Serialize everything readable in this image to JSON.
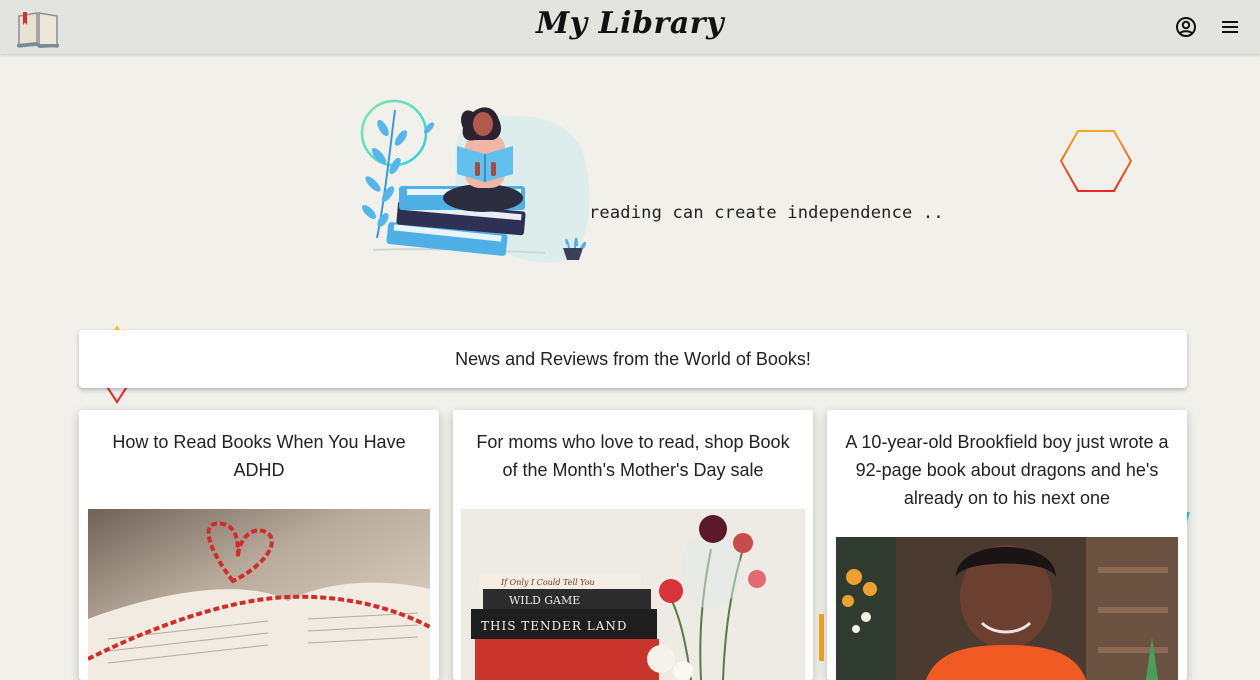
{
  "header": {
    "title": "My Library",
    "logo_icon": "open-book-icon",
    "account_icon": "account-circle-icon",
    "menu_icon": "hamburger-menu-icon"
  },
  "hero": {
    "tagline": "reading can create independence ..",
    "illustration": "woman-reading-on-books-illustration"
  },
  "news_banner": {
    "text": "News and Reviews from the World of Books!"
  },
  "articles": [
    {
      "title": "How to Read Books When You Have ADHD",
      "image": "open-book-with-red-string-heart-photo"
    },
    {
      "title": "For moms who love to read, shop Book of the Month's Mother's Day sale",
      "image": "stack-of-books-with-flowers-photo",
      "book_spines": [
        "If Only I Could Tell You",
        "WILD GAME",
        "THIS TENDER LAND"
      ]
    },
    {
      "title": "A 10-year-old Brookfield boy just wrote a 92-page book about dragons and he's already on to his next one",
      "image": "smiling-boy-portrait-photo"
    }
  ],
  "colors": {
    "page_background": "#f1f0ea",
    "topbar_background": "#e3e3df",
    "card_background": "#ffffff",
    "accent_blue": "#4aa8e0",
    "hex_outline_top": "#f5a623",
    "hex_outline_bottom": "#e8262b"
  }
}
